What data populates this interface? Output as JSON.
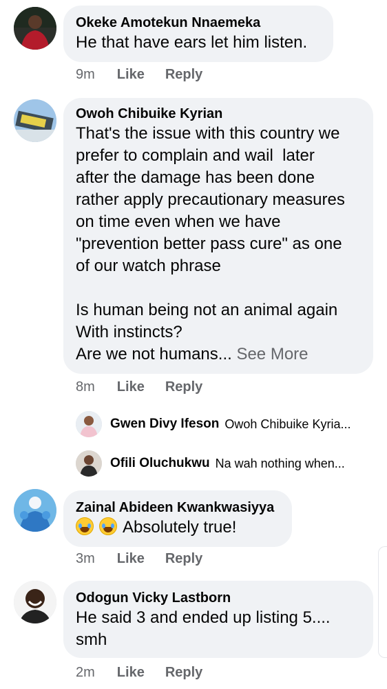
{
  "comments": [
    {
      "author": "Okeke Amotekun Nnaemeka",
      "text": "He that have ears let him listen.",
      "time": "9m",
      "like": "Like",
      "reply": "Reply"
    },
    {
      "author": "Owoh Chibuike Kyrian",
      "text": "That's the issue with this country we\nprefer to complain and wail  later\nafter the damage has been done\nrather apply precautionary measures\non time even when we have\n\"prevention better pass cure\" as one\nof our watch phrase\n\nIs human being not an animal again\nWith instincts?\nAre we not humans...",
      "see_more": "See More",
      "time": "8m",
      "like": "Like",
      "reply": "Reply",
      "replies": [
        {
          "author": "Gwen Divy Ifeson",
          "preview": "Owoh Chibuike Kyria..."
        },
        {
          "author": "Ofili Oluchukwu",
          "preview": "Na wah nothing when..."
        }
      ]
    },
    {
      "author": "Zainal Abideen Kwankwasiyya",
      "emoji": "laughing-crying-emoji",
      "text": "Absolutely true!",
      "time": "3m",
      "like": "Like",
      "reply": "Reply"
    },
    {
      "author": "Odogun Vicky Lastborn",
      "text": "He said 3 and ended up listing 5....\nsmh",
      "time": "2m",
      "like": "Like",
      "reply": "Reply"
    }
  ]
}
